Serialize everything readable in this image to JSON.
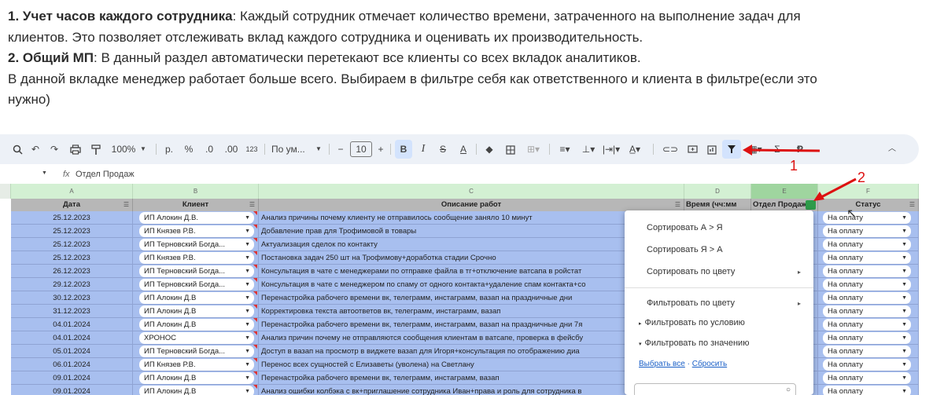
{
  "doc": {
    "p1_num": "1.",
    "p1_bold": "Учет часов каждого сотрудника",
    "p1_text": ": Каждый сотрудник отмечает количество времени, затраченного на выполнение задач для",
    "p1_line2": "клиентов. Это позволяет отслеживать вклад каждого сотрудника и оценивать их производительность.",
    "p2_num": "2.",
    "p2_bold": "Общий МП",
    "p2_text": ": В данный раздел автоматически перетекают все клиенты со всех вкладок аналитиков.",
    "p3_line1": "В данной вкладке менеджер работает больше всего.  Выбираем в фильтре себя как ответственного и клиента в фильтре(если это",
    "p3_line2": "нужно)"
  },
  "toolbar": {
    "zoom": "100%",
    "rub": "р.",
    "pct": "%",
    "dec_minus": ".0",
    "dec_plus": ".00",
    "fmt123": "123",
    "font": "По ум...",
    "font_size": "10",
    "bold": "B",
    "italic": "I",
    "strike": "S",
    "textcolor": "A"
  },
  "formula": {
    "cell_value": "Отдел Продаж",
    "fx": "fx"
  },
  "columns": [
    "A",
    "B",
    "C",
    "D",
    "E",
    "F"
  ],
  "headers": {
    "a": "Дата",
    "b": "Клиент",
    "c": "Описание работ",
    "d": "Время (чч:мм",
    "e": "Отдел Продаж",
    "f": "Статус"
  },
  "rows": [
    {
      "date": "25.12.2023",
      "client": "ИП Алокин Д.В.",
      "desc": "Анализ причины почему клиенту не отправилось сообщение заняло 10 минут",
      "status": "На оплату"
    },
    {
      "date": "25.12.2023",
      "client": "ИП Князев Р.В.",
      "desc": "Добавление прав для Трофимовой в товары",
      "status": "На оплату"
    },
    {
      "date": "25.12.2023",
      "client": "ИП Терновский Богда...",
      "desc": "Актуализация сделок по контакту",
      "status": "На оплату"
    },
    {
      "date": "25.12.2023",
      "client": "ИП Князев Р.В.",
      "desc": "Постановка задач 250 шт на Трофимову+доработка стадии Срочно",
      "status": "На оплату"
    },
    {
      "date": "26.12.2023",
      "client": "ИП Терновский Богда...",
      "desc": "Консультация в чате с менеджерами по отправке файла в тг+отключение ватсапа в ройстат",
      "status": "На оплату"
    },
    {
      "date": "29.12.2023",
      "client": "ИП Терновский Богда...",
      "desc": "Консультация в чате с менеджером по спаму от одного контакта+удаление спам контакта+со",
      "status": "На оплату"
    },
    {
      "date": "30.12.2023",
      "client": "ИП Алокин Д.В",
      "desc": "Перенастройка рабочего времени вк, телеграмм, инстаграмм, вазап на праздничные дни",
      "status": "На оплату"
    },
    {
      "date": "31.12.2023",
      "client": "ИП Алокин Д.В",
      "desc": "Корректировка текста автоответов вк, телеграмм, инстаграмм, вазап",
      "status": "На оплату"
    },
    {
      "date": "04.01.2024",
      "client": "ИП Алокин Д.В",
      "desc": "Перенастройка рабочего времени вк, телеграмм, инстаграмм, вазап на праздничные дни 7я",
      "status": "На оплату"
    },
    {
      "date": "04.01.2024",
      "client": "ХРОНОС",
      "desc": "Анализ причин почему не отправляются сообщения клиентам в ватсапе, проверка в фейсбу",
      "status": "На оплату"
    },
    {
      "date": "05.01.2024",
      "client": "ИП Терновский Богда...",
      "desc": "Доступ в вазап на просмотр в виджете вазап для Игоря+консультация по отображению диа",
      "status": "На оплату"
    },
    {
      "date": "06.01.2024",
      "client": "ИП Князев Р.В.",
      "desc": "Перенос всех сущностей с Елизаветы (уволена) на Светлану",
      "status": "На оплату"
    },
    {
      "date": "09.01.2024",
      "client": "ИП Алокин Д.В",
      "desc": "Перенастройка рабочего времени вк, телеграмм, инстаграмм, вазап",
      "status": "На оплату"
    },
    {
      "date": "09.01.2024",
      "client": "ИП Алокин Д.В",
      "desc": "Анализ ошибки колбэка с вк+приглашение сотрудника Иван+права и роль для сотрудника в",
      "status": "На оплату"
    }
  ],
  "menu": {
    "sort_az": "Сортировать А > Я",
    "sort_za": "Сортировать Я > А",
    "sort_color": "Сортировать по цвету",
    "filter_color": "Фильтровать по цвету",
    "filter_condition": "Фильтровать по условию",
    "filter_value": "Фильтровать по значению",
    "select_all": "Выбрать все",
    "reset": "Сбросить"
  },
  "annotations": {
    "one": "1",
    "two": "2"
  },
  "colors": {
    "selection": "#a8bfef",
    "header_bg": "#b7b7b7",
    "colhead_bg": "#d3f0d3",
    "annotation": "#dd1111",
    "active_btn": "#d3e3fd"
  }
}
